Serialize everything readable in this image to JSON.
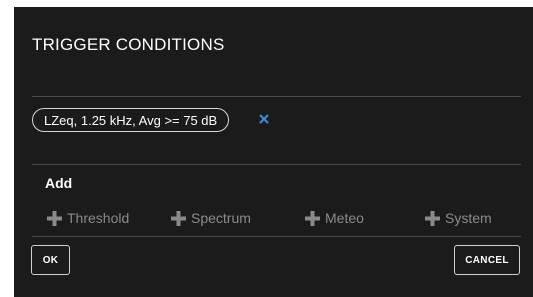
{
  "dialog": {
    "title": "TRIGGER CONDITIONS",
    "conditions": [
      {
        "label": "LZeq, 1.25 kHz, Avg >= 75 dB",
        "remove_icon": "close-icon"
      }
    ],
    "add_section": {
      "label": "Add",
      "buttons": [
        {
          "label": "Threshold",
          "icon": "plus-icon"
        },
        {
          "label": "Spectrum",
          "icon": "plus-icon"
        },
        {
          "label": "Meteo",
          "icon": "plus-icon"
        },
        {
          "label": "System",
          "icon": "plus-icon"
        }
      ]
    },
    "footer": {
      "ok_label": "OK",
      "cancel_label": "CANCEL"
    }
  },
  "colors": {
    "background": "#1b1b1b",
    "accent": "#3d8fd6",
    "muted_text": "#8a8a8a",
    "divider": "#4a4a4a"
  }
}
